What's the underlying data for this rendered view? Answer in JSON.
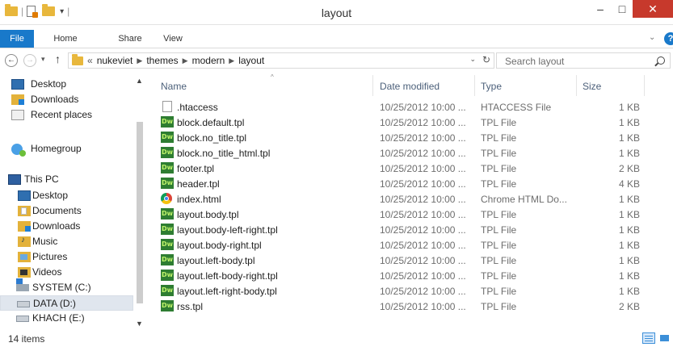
{
  "window": {
    "title": "layout",
    "minimize": "–",
    "maximize": "□",
    "close": "✕"
  },
  "qat": {
    "separator": "|",
    "dropdown": "▾"
  },
  "ribbon": {
    "tabs": [
      "File",
      "Home",
      "Share",
      "View"
    ],
    "expand": "⌄",
    "help": "?"
  },
  "nav": {
    "back": "←",
    "forward": "→",
    "recent": "▾",
    "up": "↑",
    "address_prefix": "«",
    "breadcrumbs": [
      "nukeviet",
      "themes",
      "modern",
      "layout"
    ],
    "address_dropdown": "⌄",
    "refresh": "↻"
  },
  "search": {
    "placeholder": "Search layout"
  },
  "sidebar": {
    "quick_access": [
      "Desktop",
      "Downloads",
      "Recent places"
    ],
    "homegroup": "Homegroup",
    "this_pc": "This PC",
    "pc_items": [
      "Desktop",
      "Documents",
      "Downloads",
      "Music",
      "Pictures",
      "Videos",
      "SYSTEM (C:)",
      "DATA (D:)",
      "KHACH (E:)"
    ],
    "selected": "DATA (D:)",
    "scroll_up": "▲",
    "scroll_down": "▼"
  },
  "columns": {
    "name": "Name",
    "date": "Date modified",
    "type": "Type",
    "size": "Size",
    "sort_arrow": "^"
  },
  "files": [
    {
      "name": ".htaccess",
      "date": "10/25/2012 10:00 ...",
      "type": "HTACCESS File",
      "size": "1 KB",
      "icon": "file-icon"
    },
    {
      "name": "block.default.tpl",
      "date": "10/25/2012 10:00 ...",
      "type": "TPL File",
      "size": "1 KB",
      "icon": "dreamweaver-icon"
    },
    {
      "name": "block.no_title.tpl",
      "date": "10/25/2012 10:00 ...",
      "type": "TPL File",
      "size": "1 KB",
      "icon": "dreamweaver-icon"
    },
    {
      "name": "block.no_title_html.tpl",
      "date": "10/25/2012 10:00 ...",
      "type": "TPL File",
      "size": "1 KB",
      "icon": "dreamweaver-icon"
    },
    {
      "name": "footer.tpl",
      "date": "10/25/2012 10:00 ...",
      "type": "TPL File",
      "size": "2 KB",
      "icon": "dreamweaver-icon"
    },
    {
      "name": "header.tpl",
      "date": "10/25/2012 10:00 ...",
      "type": "TPL File",
      "size": "4 KB",
      "icon": "dreamweaver-icon"
    },
    {
      "name": "index.html",
      "date": "10/25/2012 10:00 ...",
      "type": "Chrome HTML Do...",
      "size": "1 KB",
      "icon": "chrome-icon"
    },
    {
      "name": "layout.body.tpl",
      "date": "10/25/2012 10:00 ...",
      "type": "TPL File",
      "size": "1 KB",
      "icon": "dreamweaver-icon"
    },
    {
      "name": "layout.body-left-right.tpl",
      "date": "10/25/2012 10:00 ...",
      "type": "TPL File",
      "size": "1 KB",
      "icon": "dreamweaver-icon"
    },
    {
      "name": "layout.body-right.tpl",
      "date": "10/25/2012 10:00 ...",
      "type": "TPL File",
      "size": "1 KB",
      "icon": "dreamweaver-icon"
    },
    {
      "name": "layout.left-body.tpl",
      "date": "10/25/2012 10:00 ...",
      "type": "TPL File",
      "size": "1 KB",
      "icon": "dreamweaver-icon"
    },
    {
      "name": "layout.left-body-right.tpl",
      "date": "10/25/2012 10:00 ...",
      "type": "TPL File",
      "size": "1 KB",
      "icon": "dreamweaver-icon"
    },
    {
      "name": "layout.left-right-body.tpl",
      "date": "10/25/2012 10:00 ...",
      "type": "TPL File",
      "size": "1 KB",
      "icon": "dreamweaver-icon"
    },
    {
      "name": "rss.tpl",
      "date": "10/25/2012 10:00 ...",
      "type": "TPL File",
      "size": "2 KB",
      "icon": "dreamweaver-icon"
    }
  ],
  "dw_badge": "Dw",
  "status": {
    "count": "14 items"
  },
  "colors": {
    "accent": "#1979ca",
    "close": "#c7392c",
    "selection": "#e0e6ee",
    "folder": "#e8b73c"
  }
}
